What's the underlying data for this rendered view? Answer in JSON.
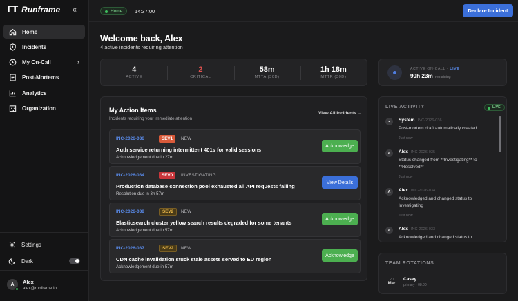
{
  "sidebar": {
    "brand": "Runframe",
    "logo": "ГТ",
    "collapse_glyph": "«",
    "items": [
      {
        "label": "Home",
        "icon": "home-icon"
      },
      {
        "label": "Incidents",
        "icon": "shield-icon"
      },
      {
        "label": "My On-Call",
        "icon": "clock-icon",
        "chevron": "›"
      },
      {
        "label": "Post-Mortems",
        "icon": "document-icon"
      },
      {
        "label": "Analytics",
        "icon": "chart-icon"
      },
      {
        "label": "Organization",
        "icon": "building-icon"
      }
    ],
    "settings_label": "Settings",
    "theme_label": "Dark",
    "user": {
      "initial": "A",
      "name": "Alex",
      "email": "alex@runframe.io"
    }
  },
  "topbar": {
    "home_badge": "Home",
    "time": "14:37:00",
    "declare_label": "Declare Incident"
  },
  "welcome": {
    "title": "Welcome back, Alex",
    "subtitle": "4 active incidents requiring attention"
  },
  "stats": [
    {
      "value": "4",
      "label": "ACTIVE"
    },
    {
      "value": "2",
      "label": "CRITICAL"
    },
    {
      "value": "58m",
      "label": "MTTA (30D)"
    },
    {
      "value": "1h 18m",
      "label": "MTTR (30D)"
    }
  ],
  "oncall": {
    "label": "ACTIVE ON-CALL",
    "sep": "·",
    "live": "LIVE",
    "time": "90h 23m",
    "remaining": "remaining"
  },
  "actions": {
    "title": "My Action Items",
    "subtitle": "Incidents requiring your immediate attention",
    "view_all": "View All Incidents →",
    "incidents": [
      {
        "id": "INC-2026-036",
        "sev": "SEV1",
        "status": "NEW",
        "title": "Auth service returning intermittent 401s for valid sessions",
        "due": "Acknowledgement due in 27m",
        "action": "Acknowledge"
      },
      {
        "id": "INC-2026-034",
        "sev": "SEV0",
        "status": "INVESTIGATING",
        "title": "Production database connection pool exhausted all API requests failing",
        "due": "Resolution due in 3h 57m",
        "action": "View Details"
      },
      {
        "id": "INC-2026-038",
        "sev": "SEV2",
        "status": "NEW",
        "title": "Elasticsearch cluster yellow search results degraded for some tenants",
        "due": "Acknowledgement due in 57m",
        "action": "Acknowledge"
      },
      {
        "id": "INC-2026-037",
        "sev": "SEV2",
        "status": "NEW",
        "title": "CDN cache invalidation stuck stale assets served to EU region",
        "due": "Acknowledgement due in 57m",
        "action": "Acknowledge"
      }
    ]
  },
  "live": {
    "title": "LIVE ACTIVITY",
    "badge": "LIVE",
    "entries": [
      {
        "avatar": "▪",
        "who": "System",
        "ref": "INC-2026-036",
        "msg": "Post-mortem draft automatically created",
        "when": "Just now"
      },
      {
        "avatar": "A",
        "who": "Alex",
        "ref": "INC-2026-035",
        "msg": "Status changed from **Investigating** to **Resolved**",
        "when": "Just now"
      },
      {
        "avatar": "A",
        "who": "Alex",
        "ref": "INC-2026-034",
        "msg": "Acknowledged and changed status to Investigating",
        "when": "Just now"
      },
      {
        "avatar": "A",
        "who": "Alex",
        "ref": "INC-2026-033",
        "msg": "Acknowledged and changed status to",
        "when": ""
      }
    ]
  },
  "rotations": {
    "title": "TEAM ROTATIONS",
    "day": "20",
    "month": "Mar",
    "name": "Casey",
    "role": "primary · 08:00"
  }
}
